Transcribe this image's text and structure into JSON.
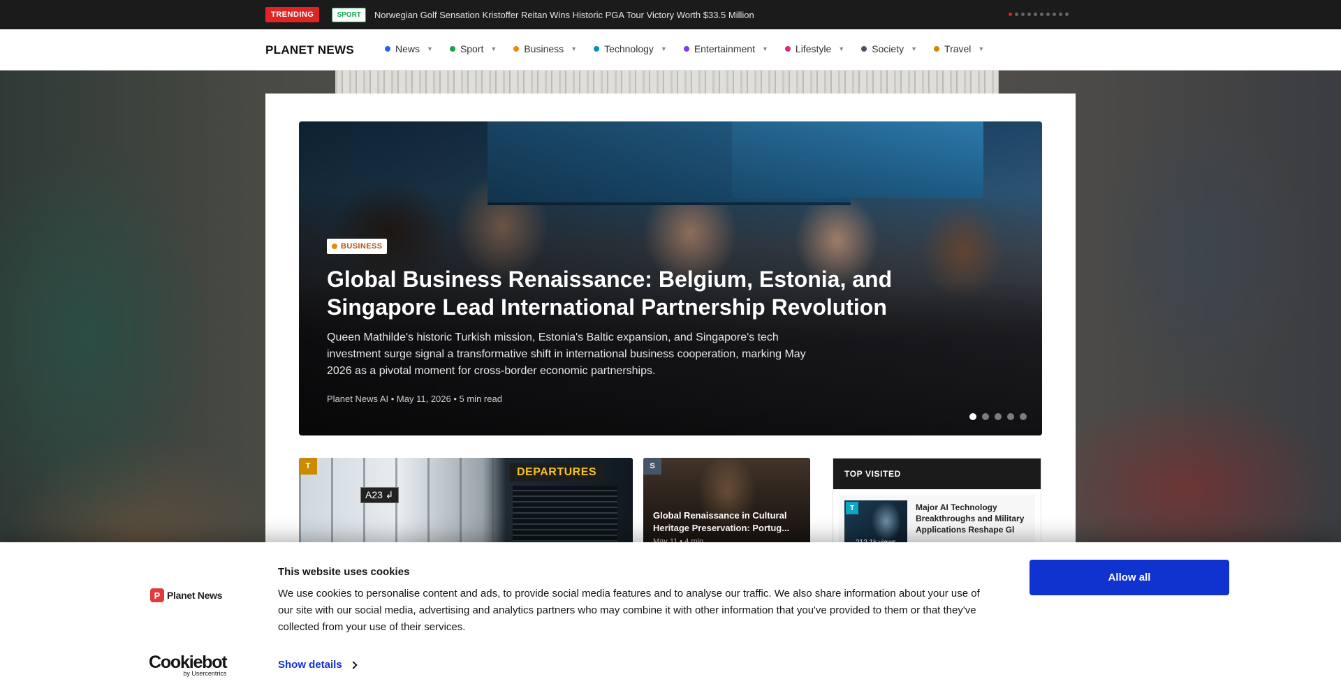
{
  "ticker": {
    "trending_label": "TRENDING",
    "category_label": "SPORT",
    "headline": "Norwegian Golf Sensation Kristoffer Reitan Wins Historic PGA Tour Victory Worth $33.5 Million",
    "dot_count": 10,
    "active_dot": 0
  },
  "nav": {
    "logo": "PLANET NEWS",
    "items": [
      {
        "label": "News",
        "color": "#2563eb"
      },
      {
        "label": "Sport",
        "color": "#16a34a"
      },
      {
        "label": "Business",
        "color": "#ea8a0c"
      },
      {
        "label": "Technology",
        "color": "#0891b2"
      },
      {
        "label": "Entertainment",
        "color": "#7c3aed"
      },
      {
        "label": "Lifestyle",
        "color": "#db2777"
      },
      {
        "label": "Society",
        "color": "#475569"
      },
      {
        "label": "Travel",
        "color": "#ca8a04"
      }
    ]
  },
  "hero": {
    "category": "BUSINESS",
    "title": "Global Business Renaissance: Belgium, Estonia, and Singapore Lead International Partnership Revolution",
    "description": "Queen Mathilde's historic Turkish mission, Estonia's Baltic expansion, and Singapore's tech investment surge signal a transformative shift in international business cooperation, marking May 2026 as a pivotal moment for cross-border economic partnerships.",
    "meta": "Planet News AI • May 11, 2026 • 5 min read",
    "slide_count": 5,
    "active_slide": 0
  },
  "cards": {
    "large": {
      "tag": "T",
      "tag_color": "#ca8a04",
      "gate_sign": "A23 ↲",
      "board_label": "DEPARTURES"
    },
    "small": {
      "tag": "S",
      "tag_color": "#475569",
      "title": "Global Renaissance in Cultural Heritage Preservation: Portug...",
      "meta": "May 11 • 4 min"
    }
  },
  "top_visited": {
    "heading": "TOP VISITED",
    "items": [
      {
        "tag": "T",
        "title": "Major AI Technology Breakthroughs and Military Applications Reshape Gl",
        "views": "212.1k views"
      }
    ]
  },
  "cookie": {
    "brand": "Planet News",
    "title": "This website uses cookies",
    "text": "We use cookies to personalise content and ads, to provide social media features and to analyse our traffic. We also share information about your use of our site with our social media, advertising and analytics partners who may combine it with other information that you've provided to them or that they've collected from your use of their services.",
    "details_label": "Show details",
    "allow_label": "Allow all",
    "provider_logo": "Cookiebot",
    "provider_sub": "by Usercentrics"
  }
}
